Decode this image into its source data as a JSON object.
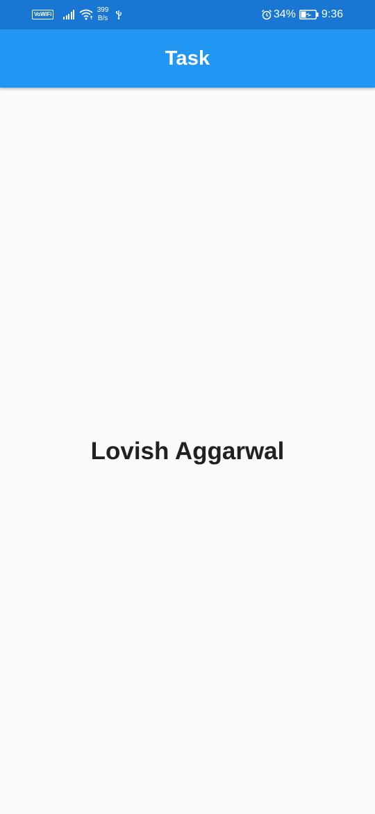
{
  "status_bar": {
    "wifi_badge": "VoWiFi",
    "net_speed_value": "399",
    "net_speed_unit": "B/s",
    "battery_percent": "34%",
    "time": "9:36",
    "icons": [
      "vowifi-icon",
      "signal-icon",
      "wifi-icon",
      "usb-icon",
      "alarm-icon",
      "battery-charging-icon"
    ]
  },
  "app_bar": {
    "title": "Task",
    "color": "#2196f3"
  },
  "main": {
    "name": "Lovish Aggarwal"
  },
  "colors": {
    "status_bar": "#1976d2",
    "background": "#fafafa",
    "text": "#212121"
  }
}
